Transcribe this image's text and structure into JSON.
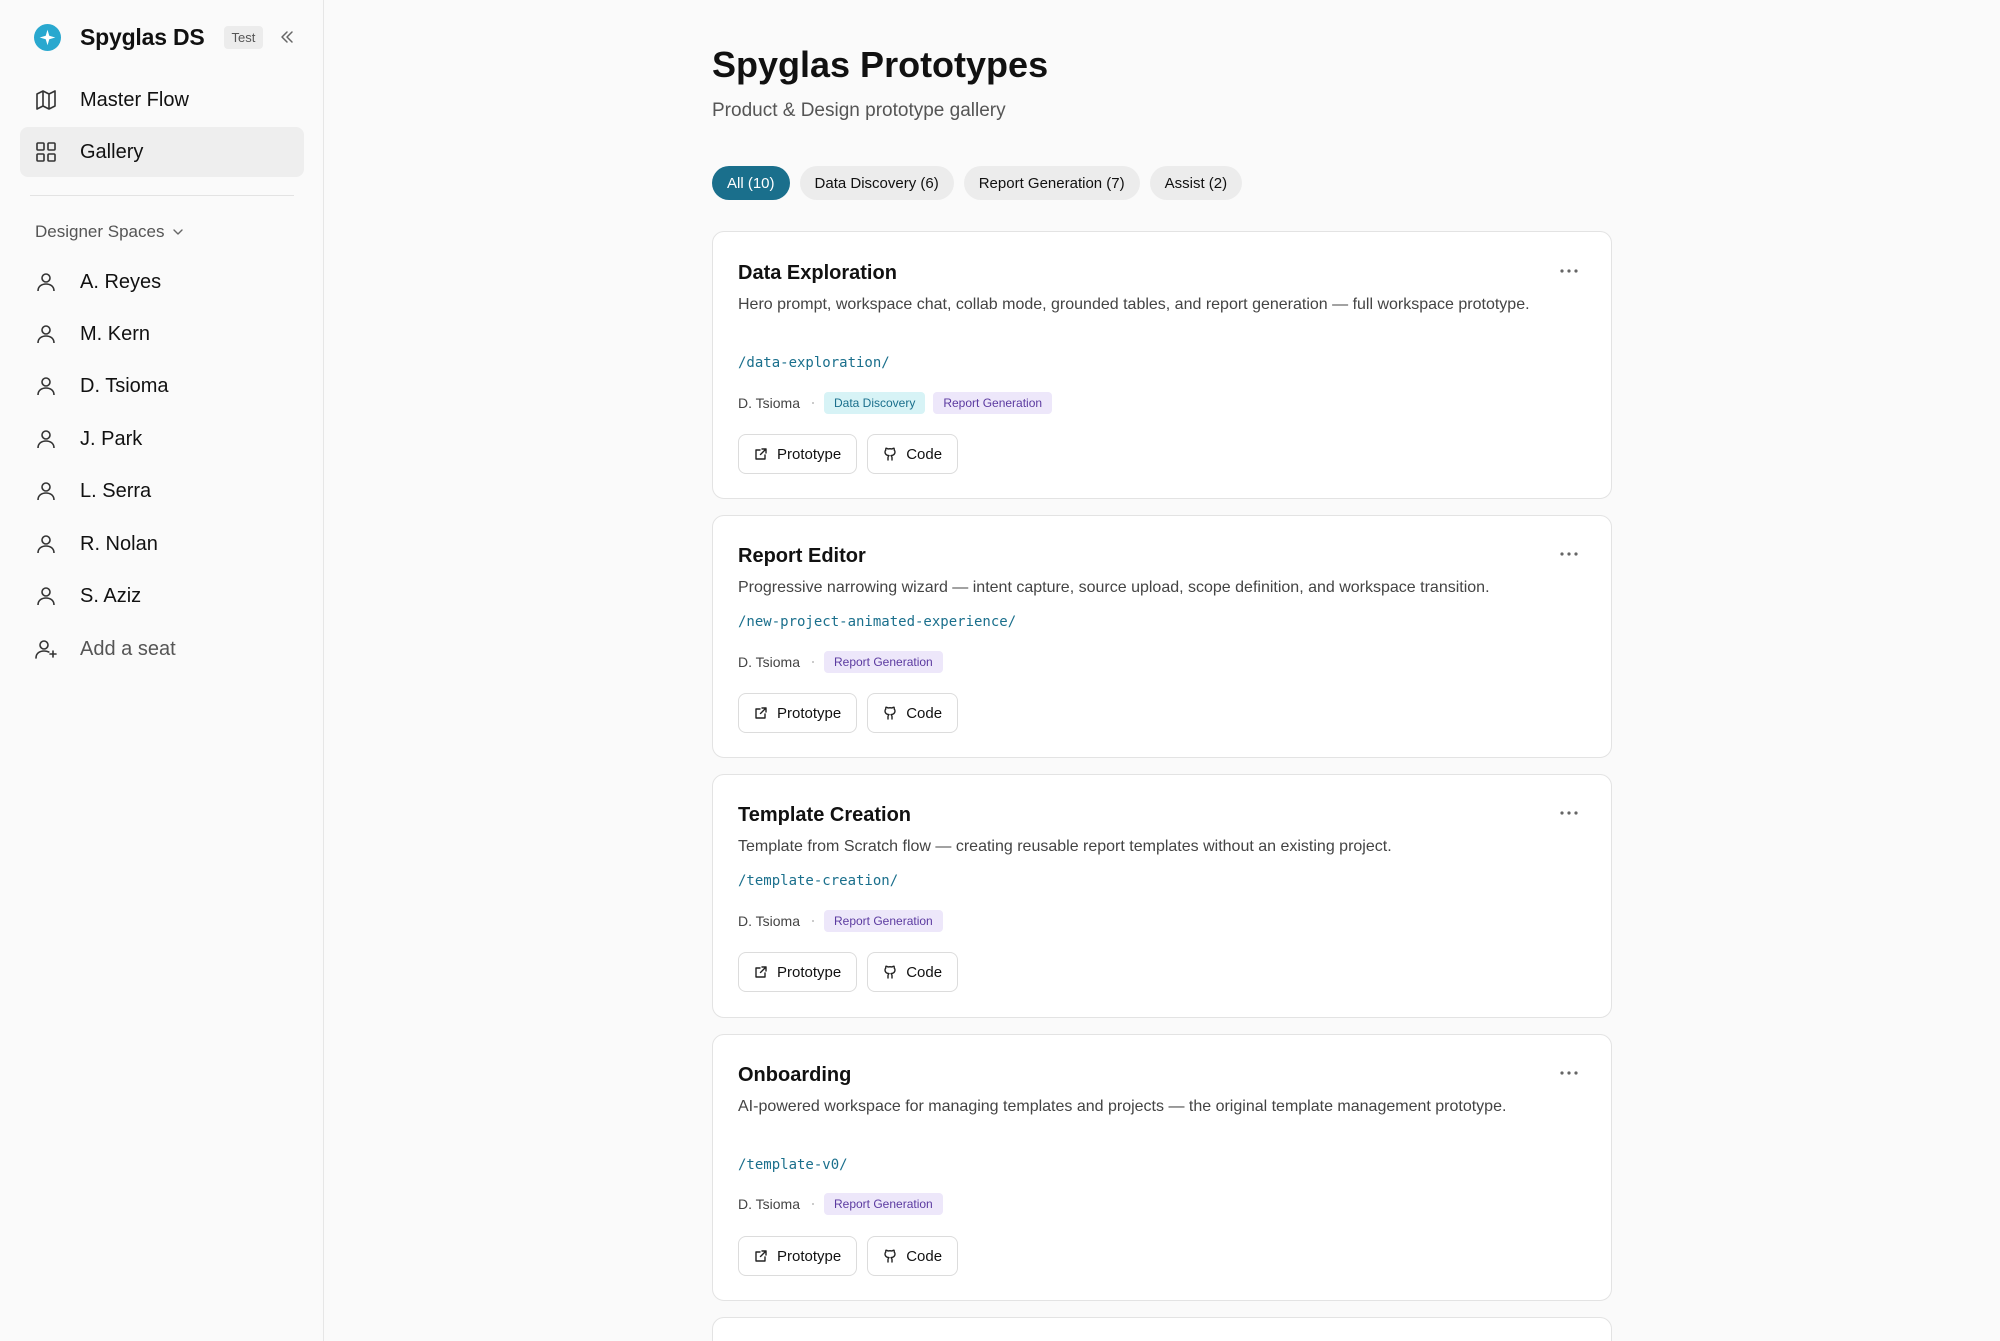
{
  "sidebar": {
    "brand": "Spyglas DS",
    "env_badge": "Test",
    "nav": [
      {
        "label": "Master Flow"
      },
      {
        "label": "Gallery"
      }
    ],
    "spaces_title": "Designer Spaces",
    "spaces": [
      {
        "label": "A. Reyes"
      },
      {
        "label": "M. Kern"
      },
      {
        "label": "D. Tsioma"
      },
      {
        "label": "J. Park"
      },
      {
        "label": "L. Serra"
      },
      {
        "label": "R. Nolan"
      },
      {
        "label": "S. Aziz"
      }
    ],
    "add_seat": "Add a seat"
  },
  "header": {
    "title": "Spyglas Prototypes",
    "subtitle": "Product & Design prototype gallery"
  },
  "filters": [
    {
      "label": "All (10)",
      "active": true
    },
    {
      "label": "Data Discovery (6)",
      "active": false
    },
    {
      "label": "Report Generation (7)",
      "active": false
    },
    {
      "label": "Assist (2)",
      "active": false
    }
  ],
  "cards": [
    {
      "title": "Data Exploration",
      "description": "Hero prompt, workspace chat, collab mode, grounded tables, and report generation — full workspace prototype.",
      "path": "/data-exploration/",
      "author": "D. Tsioma",
      "tags": [
        "Data Discovery",
        "Report Generation"
      ],
      "prototype_label": "Prototype",
      "code_label": "Code"
    },
    {
      "title": "Report Editor",
      "description": "Progressive narrowing wizard — intent capture, source upload, scope definition, and workspace transition.",
      "path": "/new-project-animated-experience/",
      "author": "D. Tsioma",
      "tags": [
        "Report Generation"
      ],
      "prototype_label": "Prototype",
      "code_label": "Code"
    },
    {
      "title": "Template Creation",
      "description": "Template from Scratch flow — creating reusable report templates without an existing project.",
      "path": "/template-creation/",
      "author": "D. Tsioma",
      "tags": [
        "Report Generation"
      ],
      "prototype_label": "Prototype",
      "code_label": "Code"
    },
    {
      "title": "Onboarding",
      "description": "AI-powered workspace for managing templates and projects — the original template management prototype.",
      "path": "/template-v0/",
      "author": "D. Tsioma",
      "tags": [
        "Report Generation"
      ],
      "prototype_label": "Prototype",
      "code_label": "Code"
    }
  ],
  "colors": {
    "accent": "#1a6f8c",
    "brand_logo": "#29a8cf",
    "tag_data_discovery_bg": "#d7f3f6",
    "tag_report_generation_bg": "#ede7fa"
  },
  "icons": {
    "brand": "sparkle-icon",
    "collapse": "double-chevron-left-icon",
    "master_flow": "map-icon",
    "gallery": "grid-icon",
    "person": "user-icon",
    "add_seat": "user-plus-icon",
    "more": "more-horizontal-icon",
    "prototype": "external-link-icon",
    "code": "github-icon"
  }
}
